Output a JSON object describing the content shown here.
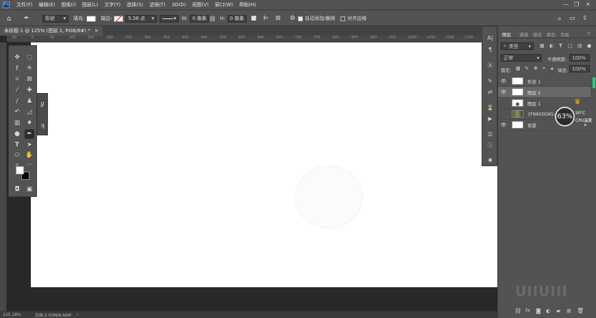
{
  "menu": {
    "logo": "Ps",
    "items": [
      "文件(F)",
      "编辑(E)",
      "图像(I)",
      "图层(L)",
      "文字(Y)",
      "选择(S)",
      "滤镜(T)",
      "3D(D)",
      "视图(V)",
      "窗口(W)",
      "帮助(H)"
    ]
  },
  "options": {
    "mode": "形状",
    "fill_label": "填充:",
    "stroke_label": "描边:",
    "stroke_width": "5.36 点",
    "w_label": "W:",
    "w_value": "0 像素",
    "h_label": "H:",
    "h_value": "0 像素",
    "auto_add_delete": "自动添加/删除",
    "align_edges": "对齐边缘"
  },
  "document": {
    "tab_title": "未标题-1 @ 125% (图层 2, RGB/8#) *",
    "ruler_top": [
      "50",
      "0",
      "50",
      "100",
      "150",
      "200",
      "250",
      "300",
      "350",
      "400",
      "450",
      "500",
      "550",
      "600",
      "650",
      "700",
      "750",
      "800",
      "850",
      "900",
      "950",
      "1000",
      "1050",
      "1100",
      "1150"
    ]
  },
  "status": {
    "zoom": "125.18%",
    "doc_info": "文档:2.03M/8.66M"
  },
  "layers_panel": {
    "tabs": [
      "图层",
      "通道",
      "路径",
      "颜色",
      "色板"
    ],
    "filter_kind": "类型",
    "blend_mode": "正常",
    "opacity_label": "不透明度:",
    "opacity": "100%",
    "lock_label": "锁定:",
    "fill_label": "填充:",
    "fill": "100%",
    "layers": [
      {
        "name": "形状 1",
        "visible": true,
        "selected": false
      },
      {
        "name": "图层 2",
        "visible": true,
        "selected": true
      },
      {
        "name": "图层 1",
        "visible": false,
        "selected": false
      },
      {
        "name": "{FB850D85-",
        "visible": false,
        "selected": false
      },
      {
        "name": "背景",
        "visible": true,
        "selected": false
      }
    ]
  },
  "cpu_widget": {
    "percent": "63%",
    "temperature": "50℃",
    "label": "CPU温度"
  },
  "watermark": "UIIUIII",
  "colors": {
    "ui_panel": "#535353",
    "ui_dark": "#282828",
    "canvas": "#ffffff",
    "accent": "#4aa3ff"
  }
}
